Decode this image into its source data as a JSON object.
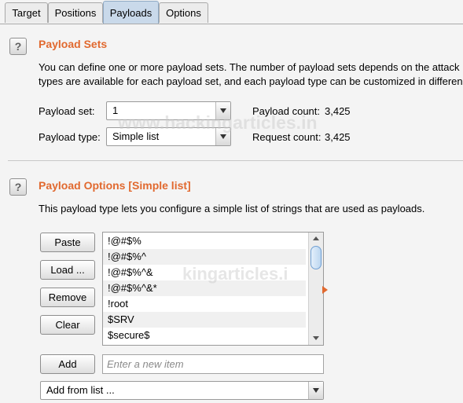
{
  "tabs": [
    {
      "label": "Target",
      "active": false
    },
    {
      "label": "Positions",
      "active": false
    },
    {
      "label": "Payloads",
      "active": true
    },
    {
      "label": "Options",
      "active": false
    }
  ],
  "payload_sets": {
    "help_icon": "?",
    "title": "Payload Sets",
    "description_line1": "You can define one or more payload sets. The number of payload sets depends on the attack",
    "description_line2": "types are available for each payload set, and each payload type can be customized in differen",
    "payload_set_label": "Payload set:",
    "payload_set_value": "1",
    "payload_type_label": "Payload type:",
    "payload_type_value": "Simple list",
    "payload_count_label": "Payload count:",
    "payload_count_value": "3,425",
    "request_count_label": "Request count:",
    "request_count_value": "3,425"
  },
  "payload_options": {
    "help_icon": "?",
    "title": "Payload Options [Simple list]",
    "description": "This payload type lets you configure a simple list of strings that are used as payloads.",
    "buttons": {
      "paste": "Paste",
      "load": "Load ...",
      "remove": "Remove",
      "clear": "Clear",
      "add": "Add"
    },
    "list_items": [
      "!@#$%",
      "!@#$%^",
      "!@#$%^&",
      "!@#$%^&*",
      "!root",
      "$SRV",
      "$secure$"
    ],
    "new_item_placeholder": "Enter a new item",
    "add_from_list_value": "Add from list ..."
  },
  "watermark": {
    "text1": "www.hackingarticles.in",
    "text2": "kingarticles.i"
  },
  "colors": {
    "accent": "#e1692f",
    "active_tab": "#c9d9ea"
  }
}
